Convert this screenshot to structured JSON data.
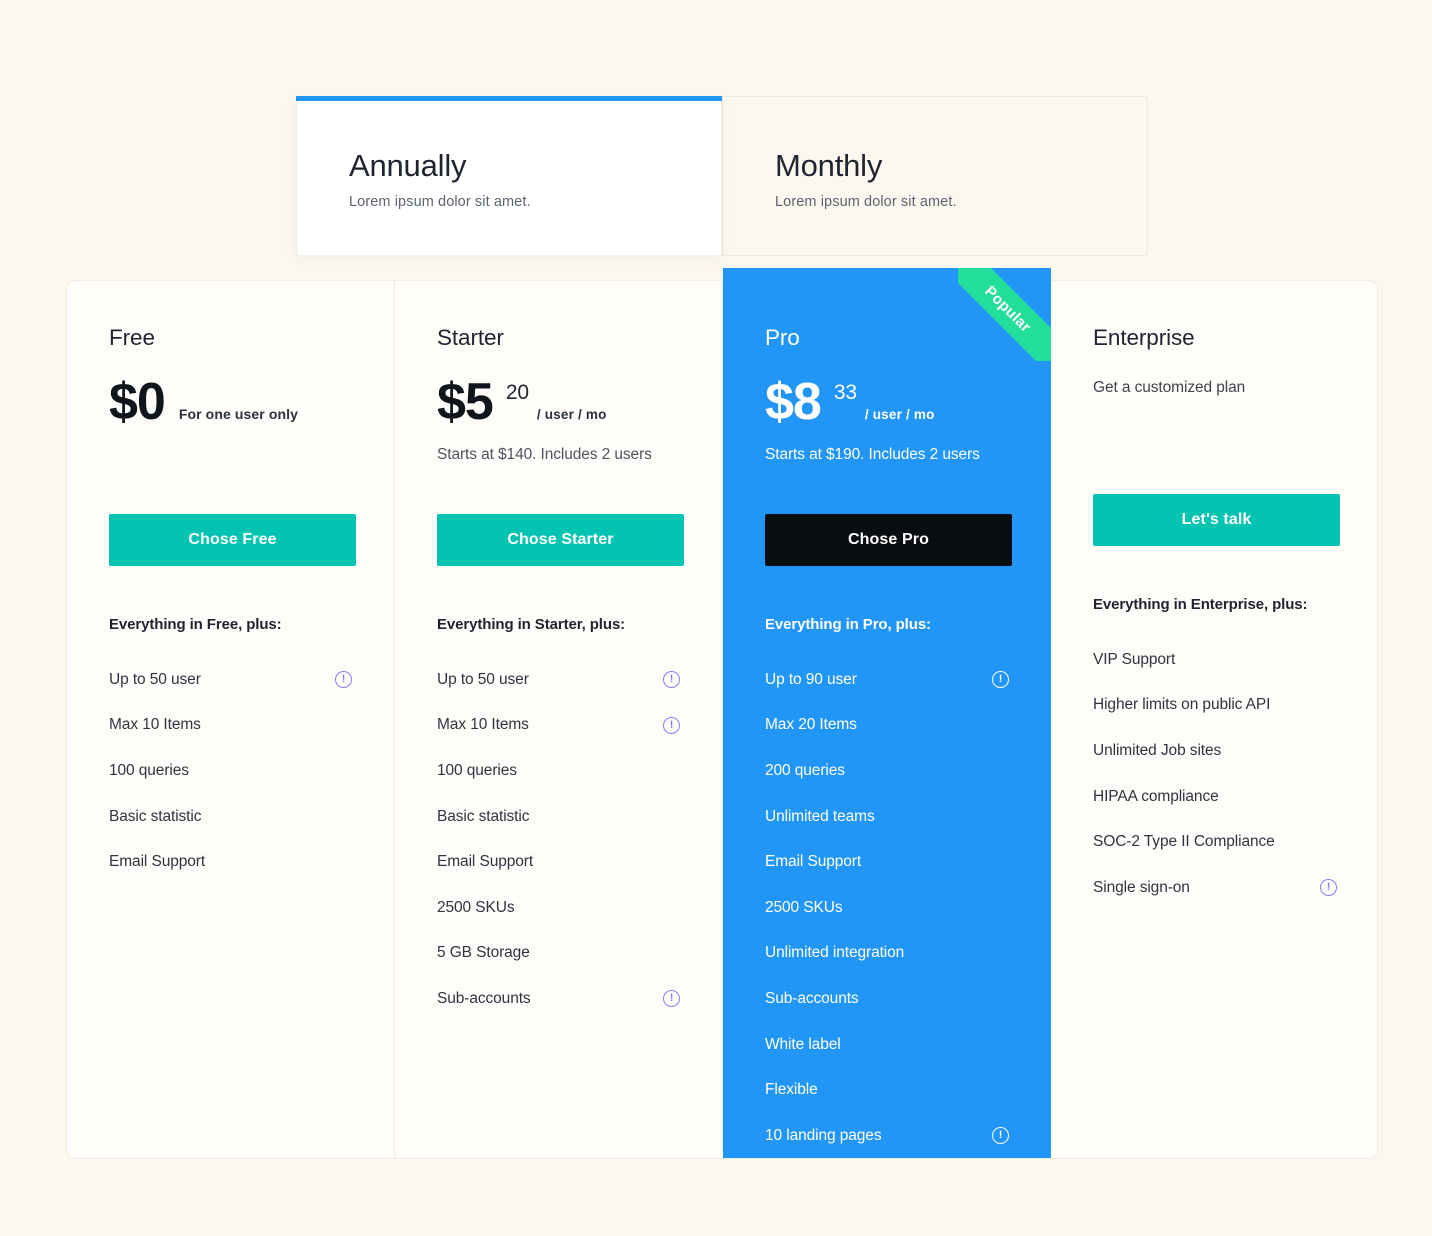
{
  "billing": {
    "tabs": [
      {
        "title": "Annually",
        "subtitle": "Lorem ipsum dolor sit amet.",
        "active": true
      },
      {
        "title": "Monthly",
        "subtitle": "Lorem ipsum dolor sit amet.",
        "active": false
      }
    ]
  },
  "colors": {
    "page_background": "#fdf8ef",
    "accent_blue": "#2196f7",
    "accent_teal": "#03c4b0",
    "ribbon_green": "#23dd9a",
    "dark_button": "#090d11",
    "info_icon_purple": "#8a7df0"
  },
  "ribbon": {
    "label": "Popular"
  },
  "plans": [
    {
      "name": "Free",
      "price_main": "$0",
      "price_cents": "",
      "price_unit": "",
      "price_note_inline": "For one user only",
      "sub_note": "",
      "description": "",
      "cta_label": "Chose Free",
      "cta_style": "teal",
      "feature_head": "Everything in Free, plus:",
      "features": [
        {
          "label": "Up to 50 user",
          "info": true
        },
        {
          "label": "Max 10 Items",
          "info": false
        },
        {
          "label": "100 queries",
          "info": false
        },
        {
          "label": "Basic statistic",
          "info": false
        },
        {
          "label": "Email Support",
          "info": false
        }
      ]
    },
    {
      "name": "Starter",
      "price_main": "$5",
      "price_cents": "20",
      "price_unit": "/ user / mo",
      "price_note_inline": "",
      "sub_note": "Starts at $140. Includes 2 users",
      "description": "",
      "cta_label": "Chose Starter",
      "cta_style": "teal",
      "feature_head": "Everything in Starter, plus:",
      "features": [
        {
          "label": "Up to 50 user",
          "info": true
        },
        {
          "label": "Max 10 Items",
          "info": true
        },
        {
          "label": "100 queries",
          "info": false
        },
        {
          "label": "Basic statistic",
          "info": false
        },
        {
          "label": "Email Support",
          "info": false
        },
        {
          "label": "2500 SKUs",
          "info": false
        },
        {
          "label": "5 GB Storage",
          "info": false
        },
        {
          "label": "Sub-accounts",
          "info": true
        }
      ]
    },
    {
      "name": "Pro",
      "price_main": "$8",
      "price_cents": "33",
      "price_unit": "/ user / mo",
      "price_note_inline": "",
      "sub_note": "Starts at $190. Includes 2 users",
      "description": "",
      "cta_label": "Chose Pro",
      "cta_style": "dark",
      "featured": true,
      "feature_head": "Everything in Pro, plus:",
      "features": [
        {
          "label": "Up to 90 user",
          "info": true
        },
        {
          "label": "Max 20 Items",
          "info": false
        },
        {
          "label": "200 queries",
          "info": false
        },
        {
          "label": "Unlimited teams",
          "info": false
        },
        {
          "label": "Email Support",
          "info": false
        },
        {
          "label": "2500 SKUs",
          "info": false
        },
        {
          "label": "Unlimited integration",
          "info": false
        },
        {
          "label": "Sub-accounts",
          "info": false
        },
        {
          "label": "White label",
          "info": false
        },
        {
          "label": "Flexible",
          "info": false
        },
        {
          "label": "10 landing pages",
          "info": true
        }
      ]
    },
    {
      "name": "Enterprise",
      "price_main": "",
      "price_cents": "",
      "price_unit": "",
      "price_note_inline": "",
      "sub_note": "",
      "description": "Get a customized plan",
      "cta_label": "Let's talk",
      "cta_style": "teal",
      "feature_head": "Everything in Enterprise, plus:",
      "features": [
        {
          "label": "VIP Support",
          "info": false
        },
        {
          "label": "Higher limits on public API",
          "info": false
        },
        {
          "label": "Unlimited Job sites",
          "info": false
        },
        {
          "label": "HIPAA compliance",
          "info": false
        },
        {
          "label": "SOC-2 Type II Compliance",
          "info": false
        },
        {
          "label": "Single sign-on",
          "info": true
        }
      ]
    }
  ]
}
